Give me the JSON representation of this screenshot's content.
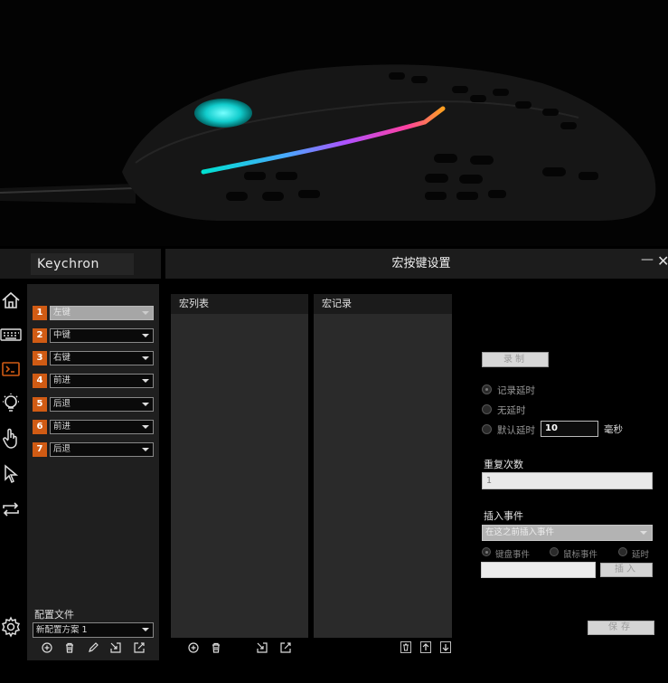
{
  "brand": {
    "logo_text": "Keychron"
  },
  "window": {
    "title": "宏按键设置",
    "minimize_glyph": "—",
    "close_glyph": "✕"
  },
  "nav": {
    "icons": [
      "home-icon",
      "keyboard-icon",
      "macro-terminal-icon",
      "lighting-bulb-icon",
      "gesture-hand-icon",
      "pointer-cursor-icon",
      "repeat-arrows-icon",
      "settings-gear-icon"
    ],
    "active": "macro-terminal-icon",
    "accent_color": "#d05b14"
  },
  "buttons": [
    {
      "number": "1",
      "value": "左键",
      "disabled": true
    },
    {
      "number": "2",
      "value": "中键",
      "disabled": false
    },
    {
      "number": "3",
      "value": "右键",
      "disabled": false
    },
    {
      "number": "4",
      "value": "前进",
      "disabled": false
    },
    {
      "number": "5",
      "value": "后退",
      "disabled": false
    },
    {
      "number": "6",
      "value": "前进",
      "disabled": false
    },
    {
      "number": "7",
      "value": "后退",
      "disabled": false
    }
  ],
  "profile": {
    "label": "配置文件",
    "selected": "新配置方案 1",
    "tools": [
      "add-icon",
      "delete-icon",
      "edit-icon",
      "import-icon",
      "export-icon"
    ]
  },
  "macro_list": {
    "header": "宏列表",
    "tools": [
      "add-icon",
      "delete-icon",
      "import-icon",
      "export-icon"
    ]
  },
  "macro_record": {
    "header": "宏记录",
    "tools": [
      "delete-icon",
      "move-up-icon",
      "move-down-icon"
    ]
  },
  "settings": {
    "record_button": "录制",
    "delay_options": [
      "记录延时",
      "无延时",
      "默认延时"
    ],
    "delay_selected": "记录延时",
    "default_delay_value": "10",
    "delay_unit": "毫秒",
    "repeat_label": "重复次数",
    "repeat_value": "1",
    "insert_label": "插入事件",
    "insert_position": "在这之前插入事件",
    "event_types": [
      "键盘事件",
      "鼠标事件",
      "延时"
    ],
    "event_selected": "键盘事件",
    "insert_button": "插入",
    "save_button": "保存"
  }
}
